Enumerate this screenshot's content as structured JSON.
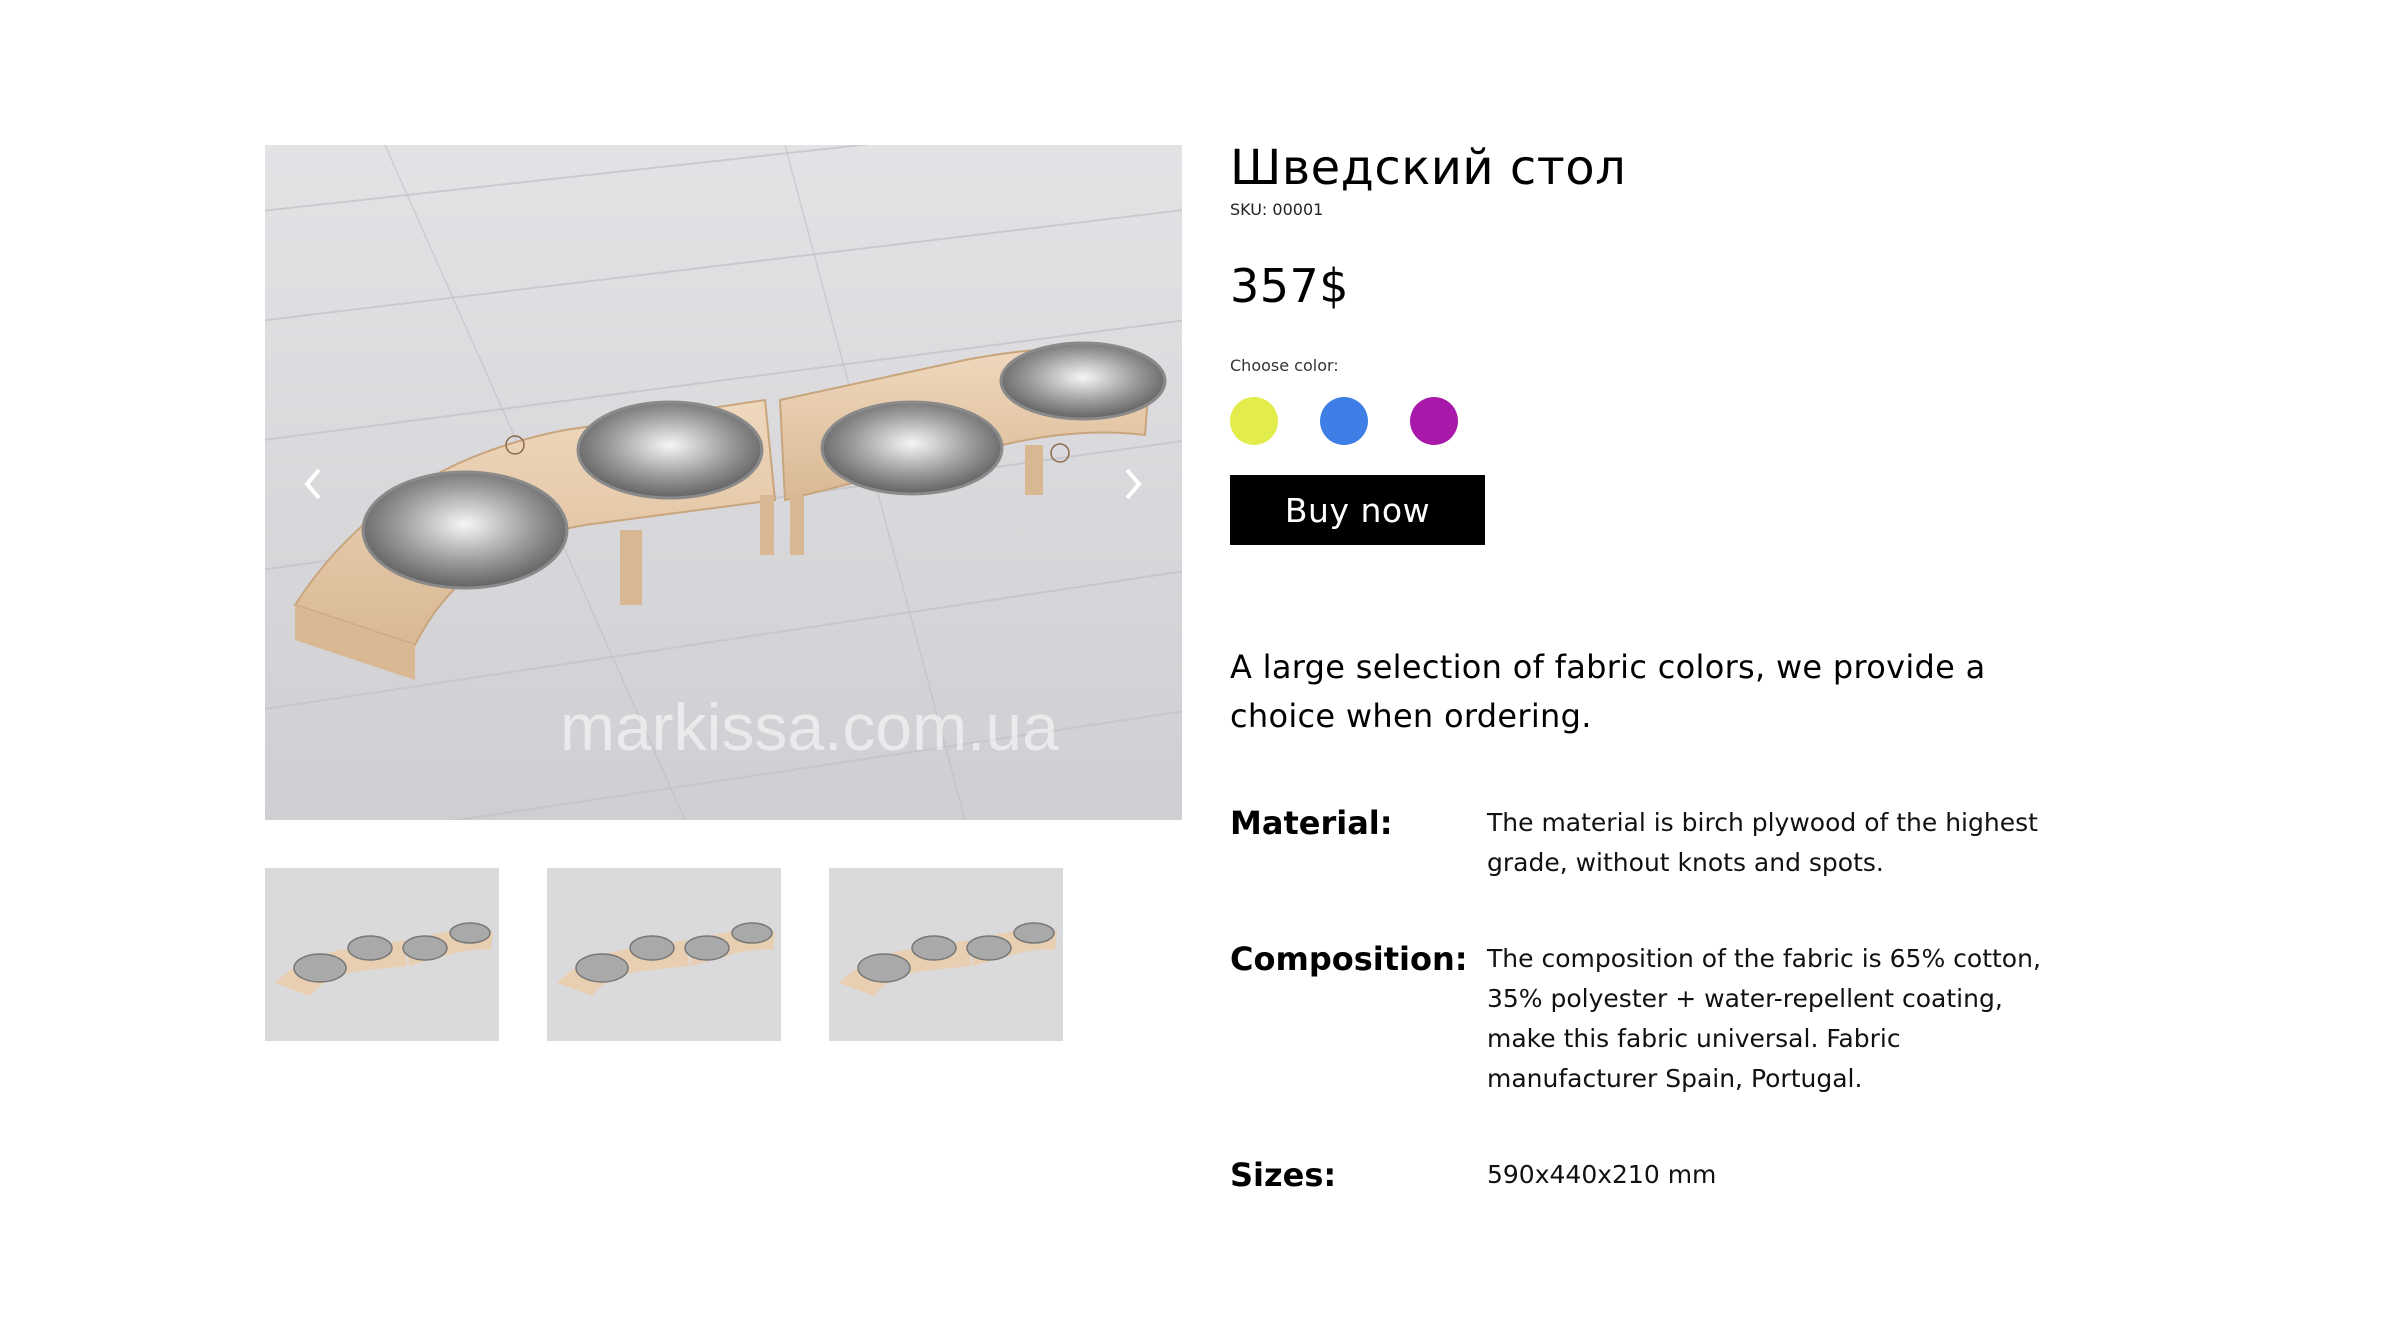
{
  "product": {
    "title": "Шведский стол",
    "sku": "SKU: 00001",
    "price": "357$",
    "choose_color_label": "Choose color:",
    "colors": [
      "#e2ec4b",
      "#3d7fe6",
      "#a818a9"
    ],
    "buy_label": "Buy now",
    "description": "A large selection of fabric colors, we provide a choice when ordering."
  },
  "gallery": {
    "watermark": "markissa.com.ua",
    "prev_icon": "chevron-left-icon",
    "next_icon": "chevron-right-icon",
    "thumbnail_count": 3
  },
  "specs": [
    {
      "label": "Material:",
      "value": "The material is birch plywood of the highest grade, without knots and spots."
    },
    {
      "label": "Composition:",
      "value": "The composition of the fabric is 65% cotton, 35% polyester + water-repellent coating, make this fabric universal. Fabric manufacturer Spain, Portugal."
    },
    {
      "label": "Sizes:",
      "value": "590x440x210 mm"
    }
  ]
}
